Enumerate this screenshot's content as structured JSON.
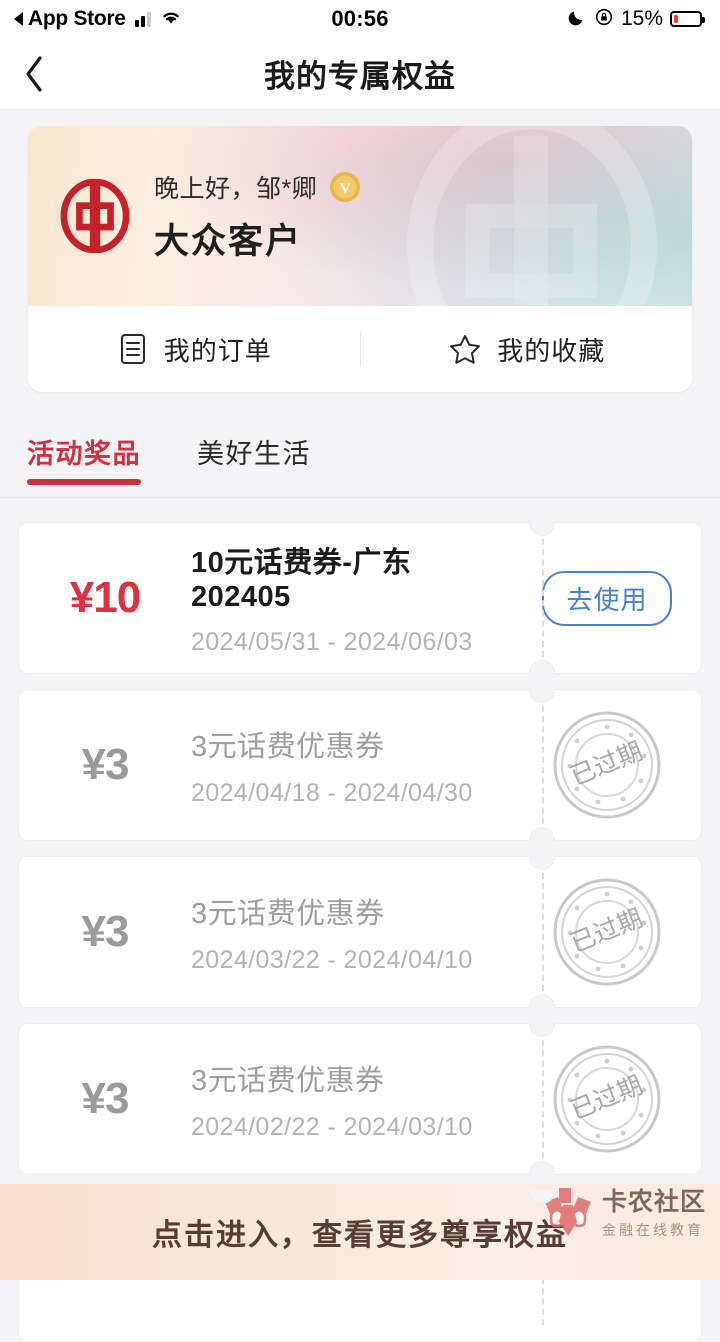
{
  "status_bar": {
    "back_app": "App Store",
    "time": "00:56",
    "battery_percent": "15%",
    "icons": [
      "signal-bars-icon",
      "wifi-icon",
      "moon-icon",
      "rotation-lock-icon",
      "battery-icon"
    ]
  },
  "nav": {
    "title": "我的专属权益",
    "back_icon": "chevron-left-icon"
  },
  "profile": {
    "greeting": "晚上好，邹*卿",
    "level": "大众客户",
    "badge_letter": "V",
    "logo_icon": "bank-of-china-logo",
    "actions": [
      {
        "label": "我的订单",
        "icon": "document-list-icon"
      },
      {
        "label": "我的收藏",
        "icon": "star-icon"
      }
    ]
  },
  "tabs": [
    {
      "label": "活动奖品",
      "active": true
    },
    {
      "label": "美好生活",
      "active": false
    }
  ],
  "coupons": [
    {
      "amount": "¥10",
      "title": "10元话费券-广东202405",
      "date_range": "2024/05/31 - 2024/06/03",
      "state": "active",
      "action_label": "去使用"
    },
    {
      "amount": "¥3",
      "title": "3元话费优惠券",
      "date_range": "2024/04/18 - 2024/04/30",
      "state": "expired",
      "action_label": "已过期"
    },
    {
      "amount": "¥3",
      "title": "3元话费优惠券",
      "date_range": "2024/03/22 - 2024/04/10",
      "state": "expired",
      "action_label": "已过期"
    },
    {
      "amount": "¥3",
      "title": "3元话费优惠券",
      "date_range": "2024/02/22 - 2024/03/10",
      "state": "expired",
      "action_label": "已过期"
    }
  ],
  "bottom_banner": {
    "text": "点击进入，查看更多尊享权益",
    "watermark_title": "卡农社区",
    "watermark_sub": "金融在线教育"
  },
  "colors": {
    "accent_red": "#c8303f",
    "coupon_red": "#e0303f",
    "use_blue": "#4a7fd6",
    "expired_gray": "#9e9e9e",
    "banner_text": "#5a3c36"
  }
}
